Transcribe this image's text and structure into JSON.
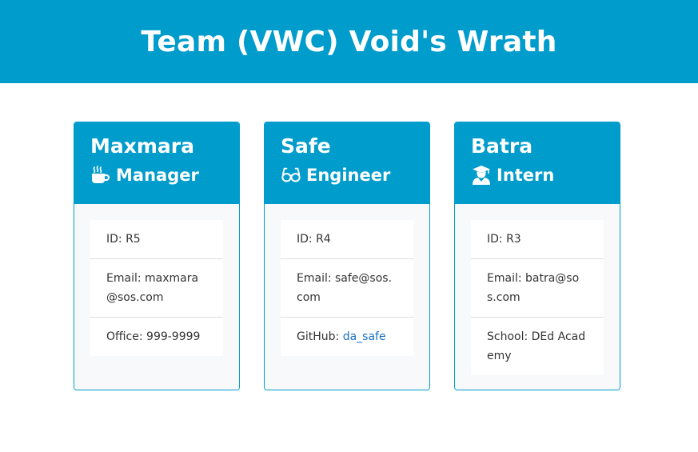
{
  "header": {
    "title": "Team (VWC) Void's Wrath"
  },
  "colors": {
    "accent": "#009ccc",
    "link": "#1a6fc4"
  },
  "cards": [
    {
      "name": "Maxmara",
      "role": "Manager",
      "role_icon": "coffee-icon",
      "items": [
        {
          "label": "ID: R5"
        },
        {
          "label": "Email: maxmara@sos.com"
        },
        {
          "label": "Office: 999-9999"
        }
      ]
    },
    {
      "name": "Safe",
      "role": "Engineer",
      "role_icon": "glasses-icon",
      "items": [
        {
          "label": "ID: R4"
        },
        {
          "label": "Email: safe@sos.com"
        },
        {
          "label": "GitHub: ",
          "link": "da_safe"
        }
      ]
    },
    {
      "name": "Batra",
      "role": "Intern",
      "role_icon": "graduate-icon",
      "items": [
        {
          "label": "ID: R3"
        },
        {
          "label": "Email: batra@sos.com"
        },
        {
          "label": "School: DEd Academy"
        }
      ]
    }
  ]
}
